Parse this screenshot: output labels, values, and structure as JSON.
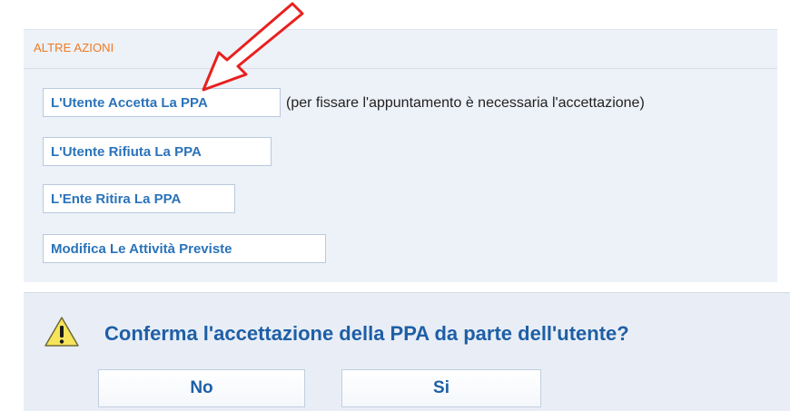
{
  "actions_panel": {
    "title": "ALTRE AZIONI",
    "buttons": [
      {
        "label": "L'Utente Accetta La PPA"
      },
      {
        "label": "L'Utente Rifiuta La PPA"
      },
      {
        "label": "L'Ente Ritira La PPA"
      },
      {
        "label": "Modifica Le Attività Previste"
      }
    ],
    "accept_note": "(per fissare l'appuntamento è necessaria l'accettazione)"
  },
  "confirm_dialog": {
    "icon": "warning-icon",
    "question": "Conferma l'accettazione della PPA da parte dell'utente?",
    "no_label": "No",
    "yes_label": "Si"
  },
  "colors": {
    "panel_title": "#f07a20",
    "button_text": "#2a73b9",
    "dialog_text": "#1e5fa6",
    "annotation_arrow": "#e8201e",
    "panel_bg": "#edf1f8"
  }
}
